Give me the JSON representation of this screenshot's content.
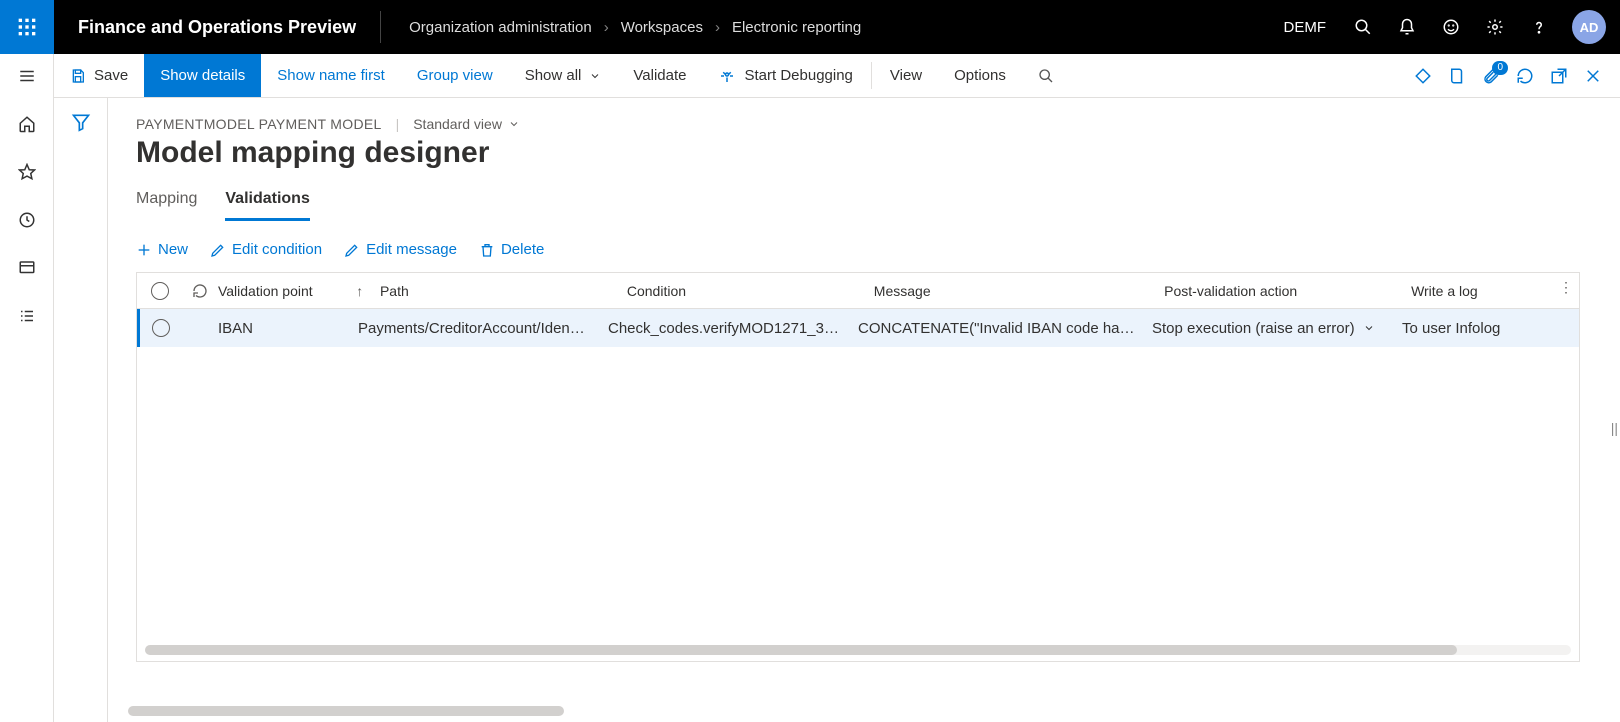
{
  "topbar": {
    "app_title": "Finance and Operations Preview",
    "breadcrumb": [
      "Organization administration",
      "Workspaces",
      "Electronic reporting"
    ],
    "legal_entity": "DEMF",
    "avatar": "AD"
  },
  "actionbar": {
    "save": "Save",
    "show_details": "Show details",
    "show_name_first": "Show name first",
    "group_view": "Group view",
    "show_all": "Show all",
    "validate": "Validate",
    "start_debugging": "Start Debugging",
    "view": "View",
    "options": "Options",
    "badge_count": "0"
  },
  "page": {
    "model_name": "PAYMENTMODEL PAYMENT MODEL",
    "view_name": "Standard view",
    "title": "Model mapping designer",
    "tabs": {
      "mapping": "Mapping",
      "validations": "Validations",
      "active": "validations"
    }
  },
  "grid_toolbar": {
    "new": "New",
    "edit_condition": "Edit condition",
    "edit_message": "Edit message",
    "delete": "Delete"
  },
  "grid": {
    "columns": {
      "validation_point": "Validation point",
      "path": "Path",
      "condition": "Condition",
      "message": "Message",
      "post_validation_action": "Post-validation action",
      "write_a_log": "Write a log"
    },
    "rows": [
      {
        "validation_point": "IBAN",
        "path": "Payments/CreditorAccount/Iden…",
        "condition": "Check_codes.verifyMOD1271_3…",
        "message": "CONCATENATE(\"Invalid IBAN code ha…",
        "post_validation_action": "Stop execution (raise an error)",
        "write_a_log": "To user Infolog"
      }
    ]
  }
}
